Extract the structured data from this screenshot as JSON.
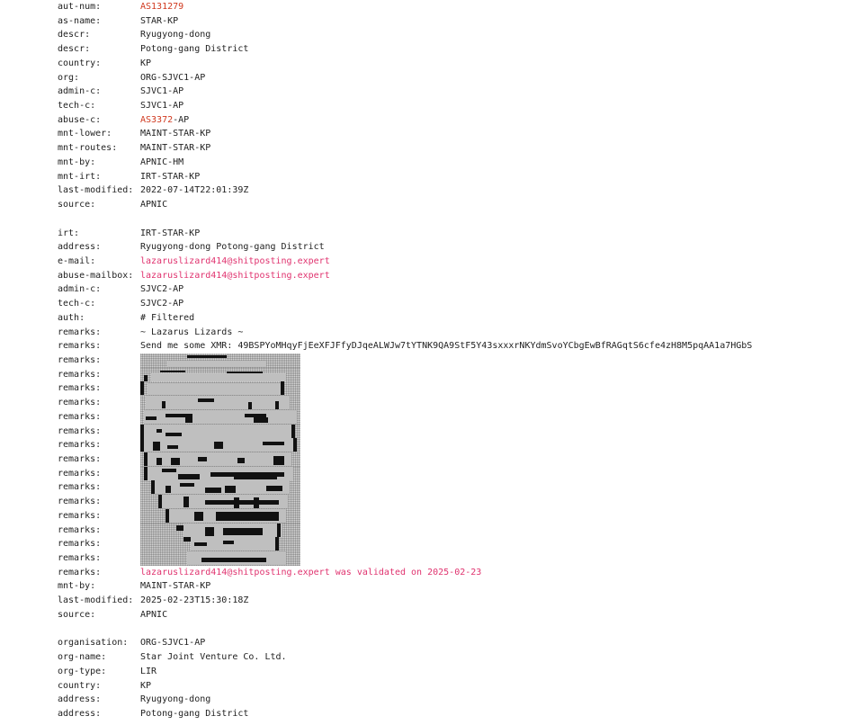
{
  "colors": {
    "text": "#222222",
    "asn_link": "#d0391f",
    "email_link": "#e0336f",
    "ascii_art_dark": "#111111",
    "ascii_art_shade": "#d4d4d4"
  },
  "sections": {
    "autnum": [
      {
        "key": "aut-num:",
        "value": "AS131279",
        "style": "link-red"
      },
      {
        "key": "as-name:",
        "value": "STAR-KP"
      },
      {
        "key": "descr:",
        "value": "Ryugyong-dong"
      },
      {
        "key": "descr:",
        "value": "Potong-gang District"
      },
      {
        "key": "country:",
        "value": "KP"
      },
      {
        "key": "org:",
        "value": "ORG-SJVC1-AP"
      },
      {
        "key": "admin-c:",
        "value": "SJVC1-AP"
      },
      {
        "key": "tech-c:",
        "value": "SJVC1-AP"
      },
      {
        "key": "abuse-c:",
        "value_link": "AS3372",
        "value_rest": "-AP"
      },
      {
        "key": "mnt-lower:",
        "value": "MAINT-STAR-KP"
      },
      {
        "key": "mnt-routes:",
        "value": "MAINT-STAR-KP"
      },
      {
        "key": "mnt-by:",
        "value": "APNIC-HM"
      },
      {
        "key": "mnt-irt:",
        "value": "IRT-STAR-KP"
      },
      {
        "key": "last-modified:",
        "value": "2022-07-14T22:01:39Z"
      },
      {
        "key": "source:",
        "value": "APNIC"
      }
    ],
    "irt_head": [
      {
        "key": "irt:",
        "value": "IRT-STAR-KP"
      },
      {
        "key": "address:",
        "value": "Ryugyong-dong Potong-gang District"
      },
      {
        "key": "e-mail:",
        "value": "lazaruslizard414@shitposting.expert",
        "style": "link-pink"
      },
      {
        "key": "abuse-mailbox:",
        "value": "lazaruslizard414@shitposting.expert",
        "style": "link-pink"
      },
      {
        "key": "admin-c:",
        "value": "SJVC2-AP"
      },
      {
        "key": "tech-c:",
        "value": "SJVC2-AP"
      },
      {
        "key": "auth:",
        "value": "# Filtered"
      },
      {
        "key": "remarks:",
        "value": "~ Lazarus Lizards ~"
      },
      {
        "key": "remarks:",
        "value": "Send me some XMR: 49BSPYoMHqyFjEeXFJFfyDJqeALWJw7tYTNK9QA9StF5Y43sxxxrNKYdmSvoYCbgEwBfRAGqtS6cfe4zH8M5pqAA1a7HGbS"
      }
    ],
    "art_key": "remarks:",
    "irt_tail": [
      {
        "key": "remarks:",
        "value_link": "lazaruslizard414@shitposting.expert",
        "value_rest": " was validated on 2025-02-23",
        "style": "link-pink"
      },
      {
        "key": "mnt-by:",
        "value": "MAINT-STAR-KP"
      },
      {
        "key": "last-modified:",
        "value": "2025-02-23T15:30:18Z"
      },
      {
        "key": "source:",
        "value": "APNIC"
      }
    ],
    "organisation": [
      {
        "key": "organisation:",
        "value": "ORG-SJVC1-AP"
      },
      {
        "key": "org-name:",
        "value": "Star Joint Venture Co. Ltd."
      },
      {
        "key": "org-type:",
        "value": "LIR"
      },
      {
        "key": "country:",
        "value": "KP"
      },
      {
        "key": "address:",
        "value": "Ryugyong-dong"
      },
      {
        "key": "address:",
        "value": "Potong-gang District"
      }
    ]
  }
}
